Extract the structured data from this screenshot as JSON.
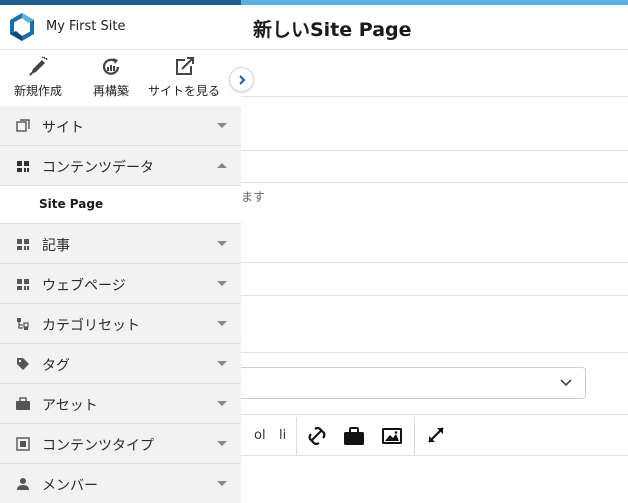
{
  "colors": {
    "accent_dark": "#1d5f8c",
    "accent_light": "#5ab0df",
    "sidebar_bg": "#f2f2f2"
  },
  "sidebar": {
    "site_name": "My First Site",
    "actions": [
      {
        "label": "新規作成",
        "icon": "pencil-icon"
      },
      {
        "label": "再構築",
        "icon": "rebuild-icon"
      },
      {
        "label": "サイトを見る",
        "icon": "external-link-icon"
      }
    ],
    "items": [
      {
        "label": "サイト",
        "icon": "site-icon"
      },
      {
        "label": "コンテンツデータ",
        "icon": "content-data-icon",
        "expanded": true
      },
      {
        "label": "Site Page",
        "sub": true
      },
      {
        "label": "記事",
        "icon": "entry-icon"
      },
      {
        "label": "ウェブページ",
        "icon": "webpage-icon"
      },
      {
        "label": "カテゴリセット",
        "icon": "category-set-icon"
      },
      {
        "label": "タグ",
        "icon": "tag-icon"
      },
      {
        "label": "アセット",
        "icon": "asset-icon"
      },
      {
        "label": "コンテンツタイプ",
        "icon": "content-type-icon"
      },
      {
        "label": "メンバー",
        "icon": "member-icon"
      }
    ]
  },
  "main": {
    "title": "新しいSite Page",
    "hint_fragment": "ます",
    "toolbar": {
      "ol_label": "ol",
      "li_label": "li"
    }
  }
}
